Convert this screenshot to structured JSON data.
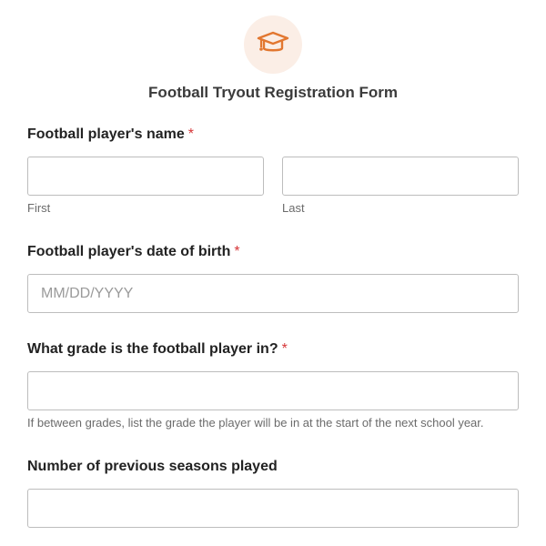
{
  "header": {
    "logo_icon": "graduation-cap-icon",
    "title": "Football Tryout Registration Form",
    "accent_color": "#e27730",
    "logo_bg_color": "#fbeee6"
  },
  "fields": {
    "name": {
      "label": "Football player's name",
      "required_mark": "*",
      "first_sublabel": "First",
      "last_sublabel": "Last",
      "first_value": "",
      "last_value": ""
    },
    "dob": {
      "label": "Football player's date of birth",
      "required_mark": "*",
      "placeholder": "MM/DD/YYYY",
      "value": ""
    },
    "grade": {
      "label": "What grade is the football player in?",
      "required_mark": "*",
      "value": "",
      "help_text": "If between grades, list the grade the player will be in at the start of the next school year."
    },
    "seasons": {
      "label": "Number of previous seasons played",
      "value": ""
    }
  },
  "colors": {
    "required": "#d63638",
    "border": "#bdbdbd"
  }
}
